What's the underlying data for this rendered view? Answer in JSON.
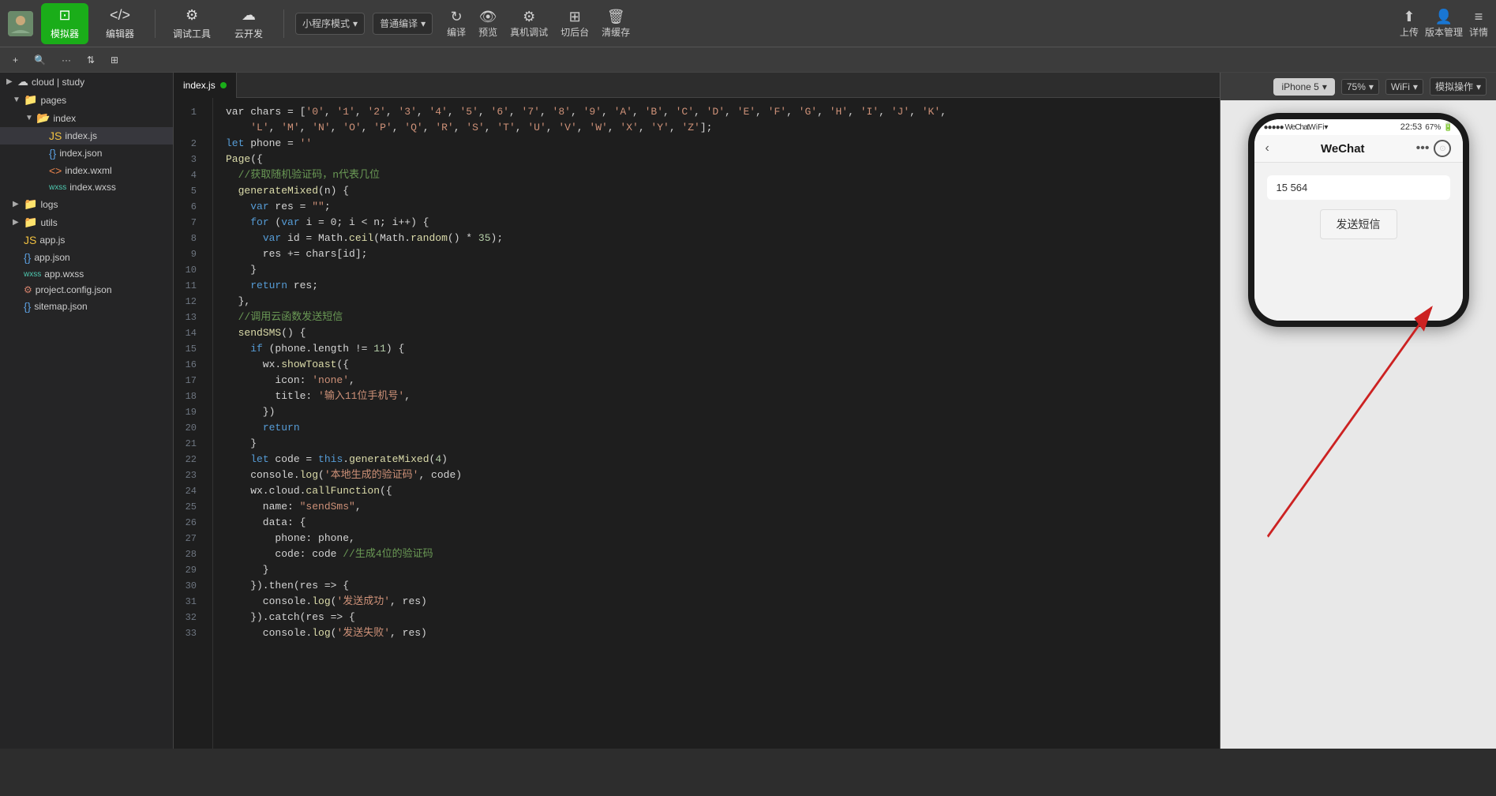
{
  "toolbar": {
    "avatar_alt": "user avatar",
    "simulator_label": "模拟器",
    "editor_label": "编辑器",
    "devtools_label": "调试工具",
    "cloud_label": "云开发",
    "mode_label": "小程序模式",
    "compile_label": "普通编译",
    "compile_btn": "编译",
    "preview_btn": "预览",
    "real_debug_btn": "真机调试",
    "cut_backend_btn": "切后台",
    "clear_cache_btn": "清缓存",
    "upload_btn": "上传",
    "version_btn": "版本管理",
    "detail_btn": "详情"
  },
  "second_toolbar": {
    "add_btn": "+",
    "search_btn": "🔍",
    "more_btn": "···",
    "sort_btn": "⇅",
    "filter_btn": "⊞"
  },
  "sidebar": {
    "items": [
      {
        "label": "cloud | study",
        "type": "root",
        "expanded": false
      },
      {
        "label": "pages",
        "type": "folder",
        "expanded": true,
        "indent": 1
      },
      {
        "label": "index",
        "type": "folder",
        "expanded": true,
        "indent": 2
      },
      {
        "label": "index.js",
        "type": "js",
        "indent": 3,
        "active": true
      },
      {
        "label": "index.json",
        "type": "json",
        "indent": 3
      },
      {
        "label": "index.wxml",
        "type": "wxml",
        "indent": 3
      },
      {
        "label": "index.wxss",
        "type": "wxss",
        "indent": 3
      },
      {
        "label": "logs",
        "type": "folder",
        "expanded": false,
        "indent": 1
      },
      {
        "label": "utils",
        "type": "folder",
        "expanded": false,
        "indent": 1
      },
      {
        "label": "app.js",
        "type": "js",
        "indent": 1
      },
      {
        "label": "app.json",
        "type": "json",
        "indent": 1
      },
      {
        "label": "app.wxss",
        "type": "wxss",
        "indent": 1
      },
      {
        "label": "project.config.json",
        "type": "config",
        "indent": 1
      },
      {
        "label": "sitemap.json",
        "type": "json",
        "indent": 1
      }
    ]
  },
  "editor": {
    "tab": "index.js",
    "lines": [
      {
        "num": 1,
        "tokens": [
          {
            "t": "default",
            "v": "var chars = ["
          },
          {
            "t": "string",
            "v": "'0'"
          },
          {
            "t": "default",
            "v": ", "
          },
          {
            "t": "string",
            "v": "'1'"
          },
          {
            "t": "default",
            "v": ", "
          },
          {
            "t": "string",
            "v": "'2'"
          },
          {
            "t": "default",
            "v": ", "
          },
          {
            "t": "string",
            "v": "'3'"
          },
          {
            "t": "default",
            "v": ", "
          },
          {
            "t": "string",
            "v": "'4'"
          },
          {
            "t": "default",
            "v": ", "
          },
          {
            "t": "string",
            "v": "'5'"
          },
          {
            "t": "default",
            "v": ", "
          },
          {
            "t": "string",
            "v": "'6'"
          },
          {
            "t": "default",
            "v": ", "
          },
          {
            "t": "string",
            "v": "'7'"
          },
          {
            "t": "default",
            "v": ", "
          },
          {
            "t": "string",
            "v": "'8'"
          },
          {
            "t": "default",
            "v": ", "
          },
          {
            "t": "string",
            "v": "'9'"
          },
          {
            "t": "default",
            "v": ", "
          },
          {
            "t": "string",
            "v": "'A'"
          },
          {
            "t": "default",
            "v": ", "
          },
          {
            "t": "string",
            "v": "'B'"
          },
          {
            "t": "default",
            "v": ", "
          },
          {
            "t": "string",
            "v": "'C'"
          },
          {
            "t": "default",
            "v": ", "
          },
          {
            "t": "string",
            "v": "'D'"
          },
          {
            "t": "default",
            "v": ", "
          },
          {
            "t": "string",
            "v": "'E'"
          },
          {
            "t": "default",
            "v": ", "
          },
          {
            "t": "string",
            "v": "'F'"
          },
          {
            "t": "default",
            "v": ", "
          },
          {
            "t": "string",
            "v": "'G'"
          },
          {
            "t": "default",
            "v": ", "
          },
          {
            "t": "string",
            "v": "'H'"
          },
          {
            "t": "default",
            "v": ", "
          },
          {
            "t": "string",
            "v": "'I'"
          },
          {
            "t": "default",
            "v": ", "
          },
          {
            "t": "string",
            "v": "'J'"
          },
          {
            "t": "default",
            "v": ", "
          },
          {
            "t": "string",
            "v": "'K'"
          },
          {
            "t": "default",
            "v": ","
          }
        ]
      },
      {
        "num": "",
        "tokens": [
          {
            "t": "default",
            "v": "    "
          },
          {
            "t": "string",
            "v": "'L'"
          },
          {
            "t": "default",
            "v": ", "
          },
          {
            "t": "string",
            "v": "'M'"
          },
          {
            "t": "default",
            "v": ", "
          },
          {
            "t": "string",
            "v": "'N'"
          },
          {
            "t": "default",
            "v": ", "
          },
          {
            "t": "string",
            "v": "'O'"
          },
          {
            "t": "default",
            "v": ", "
          },
          {
            "t": "string",
            "v": "'P'"
          },
          {
            "t": "default",
            "v": ", "
          },
          {
            "t": "string",
            "v": "'Q'"
          },
          {
            "t": "default",
            "v": ", "
          },
          {
            "t": "string",
            "v": "'R'"
          },
          {
            "t": "default",
            "v": ", "
          },
          {
            "t": "string",
            "v": "'S'"
          },
          {
            "t": "default",
            "v": ", "
          },
          {
            "t": "string",
            "v": "'T'"
          },
          {
            "t": "default",
            "v": ", "
          },
          {
            "t": "string",
            "v": "'U'"
          },
          {
            "t": "default",
            "v": ", "
          },
          {
            "t": "string",
            "v": "'V'"
          },
          {
            "t": "default",
            "v": ", "
          },
          {
            "t": "string",
            "v": "'W'"
          },
          {
            "t": "default",
            "v": ", "
          },
          {
            "t": "string",
            "v": "'X'"
          },
          {
            "t": "default",
            "v": ", "
          },
          {
            "t": "string",
            "v": "'Y'"
          },
          {
            "t": "default",
            "v": ", "
          },
          {
            "t": "string",
            "v": "'Z'"
          },
          {
            "t": "default",
            "v": "];"
          }
        ]
      },
      {
        "num": 2,
        "tokens": [
          {
            "t": "keyword",
            "v": "let"
          },
          {
            "t": "default",
            "v": " phone = "
          },
          {
            "t": "string",
            "v": "''"
          }
        ]
      },
      {
        "num": 3,
        "tokens": [
          {
            "t": "func",
            "v": "Page"
          },
          {
            "t": "default",
            "v": "({"
          }
        ]
      },
      {
        "num": 4,
        "tokens": [
          {
            "t": "comment",
            "v": "  //获取随机验证码，n代表几位"
          }
        ]
      },
      {
        "num": 5,
        "tokens": [
          {
            "t": "default",
            "v": "  "
          },
          {
            "t": "func",
            "v": "generateMixed"
          },
          {
            "t": "default",
            "v": "(n) {"
          }
        ]
      },
      {
        "num": 6,
        "tokens": [
          {
            "t": "default",
            "v": "    "
          },
          {
            "t": "keyword",
            "v": "var"
          },
          {
            "t": "default",
            "v": " res = "
          },
          {
            "t": "string",
            "v": "\"\""
          },
          {
            "t": "default",
            "v": ";"
          }
        ]
      },
      {
        "num": 7,
        "tokens": [
          {
            "t": "default",
            "v": "    "
          },
          {
            "t": "keyword",
            "v": "for"
          },
          {
            "t": "default",
            "v": " ("
          },
          {
            "t": "keyword",
            "v": "var"
          },
          {
            "t": "default",
            "v": " i = 0; i < n; i++) {"
          }
        ]
      },
      {
        "num": 8,
        "tokens": [
          {
            "t": "default",
            "v": "      "
          },
          {
            "t": "keyword",
            "v": "var"
          },
          {
            "t": "default",
            "v": " id = Math."
          },
          {
            "t": "func",
            "v": "ceil"
          },
          {
            "t": "default",
            "v": "(Math."
          },
          {
            "t": "func",
            "v": "random"
          },
          {
            "t": "default",
            "v": "() * "
          },
          {
            "t": "number",
            "v": "35"
          },
          {
            "t": "default",
            "v": ");"
          }
        ]
      },
      {
        "num": 9,
        "tokens": [
          {
            "t": "default",
            "v": "      res += chars[id];"
          }
        ]
      },
      {
        "num": 10,
        "tokens": [
          {
            "t": "default",
            "v": "    }"
          }
        ]
      },
      {
        "num": 11,
        "tokens": [
          {
            "t": "default",
            "v": "    "
          },
          {
            "t": "keyword",
            "v": "return"
          },
          {
            "t": "default",
            "v": " res;"
          }
        ]
      },
      {
        "num": 12,
        "tokens": [
          {
            "t": "default",
            "v": "  },"
          }
        ]
      },
      {
        "num": 13,
        "tokens": [
          {
            "t": "comment",
            "v": "  //调用云函数发送短信"
          }
        ]
      },
      {
        "num": 14,
        "tokens": [
          {
            "t": "default",
            "v": "  "
          },
          {
            "t": "func",
            "v": "sendSMS"
          },
          {
            "t": "default",
            "v": "() {"
          }
        ]
      },
      {
        "num": 15,
        "tokens": [
          {
            "t": "default",
            "v": "    "
          },
          {
            "t": "keyword",
            "v": "if"
          },
          {
            "t": "default",
            "v": " (phone.length != "
          },
          {
            "t": "number",
            "v": "11"
          },
          {
            "t": "default",
            "v": ") {"
          }
        ]
      },
      {
        "num": 16,
        "tokens": [
          {
            "t": "default",
            "v": "      wx."
          },
          {
            "t": "func",
            "v": "showToast"
          },
          {
            "t": "default",
            "v": "({"
          }
        ]
      },
      {
        "num": 17,
        "tokens": [
          {
            "t": "default",
            "v": "        icon: "
          },
          {
            "t": "string",
            "v": "'none'"
          },
          {
            "t": "default",
            "v": ","
          }
        ]
      },
      {
        "num": 18,
        "tokens": [
          {
            "t": "default",
            "v": "        title: "
          },
          {
            "t": "string",
            "v": "'输入11位手机号'"
          },
          {
            "t": "default",
            "v": ","
          }
        ]
      },
      {
        "num": 19,
        "tokens": [
          {
            "t": "default",
            "v": "      })"
          }
        ]
      },
      {
        "num": 20,
        "tokens": [
          {
            "t": "default",
            "v": "      "
          },
          {
            "t": "keyword",
            "v": "return"
          }
        ]
      },
      {
        "num": 21,
        "tokens": [
          {
            "t": "default",
            "v": "    }"
          }
        ]
      },
      {
        "num": 22,
        "tokens": [
          {
            "t": "default",
            "v": "    "
          },
          {
            "t": "keyword",
            "v": "let"
          },
          {
            "t": "default",
            "v": " code = "
          },
          {
            "t": "keyword",
            "v": "this"
          },
          {
            "t": "default",
            "v": "."
          },
          {
            "t": "func",
            "v": "generateMixed"
          },
          {
            "t": "default",
            "v": "("
          },
          {
            "t": "number",
            "v": "4"
          },
          {
            "t": "default",
            "v": ")"
          }
        ]
      },
      {
        "num": 23,
        "tokens": [
          {
            "t": "default",
            "v": "    console."
          },
          {
            "t": "func",
            "v": "log"
          },
          {
            "t": "default",
            "v": "("
          },
          {
            "t": "string",
            "v": "'本地生成的验证码'"
          },
          {
            "t": "default",
            "v": ", code)"
          }
        ]
      },
      {
        "num": 24,
        "tokens": [
          {
            "t": "default",
            "v": "    wx.cloud."
          },
          {
            "t": "func",
            "v": "callFunction"
          },
          {
            "t": "default",
            "v": "({"
          }
        ]
      },
      {
        "num": 25,
        "tokens": [
          {
            "t": "default",
            "v": "      name: "
          },
          {
            "t": "string",
            "v": "\"sendSms\""
          },
          {
            "t": "default",
            "v": ","
          }
        ]
      },
      {
        "num": 26,
        "tokens": [
          {
            "t": "default",
            "v": "      data: {"
          }
        ]
      },
      {
        "num": 27,
        "tokens": [
          {
            "t": "default",
            "v": "        phone: phone,"
          }
        ]
      },
      {
        "num": 28,
        "tokens": [
          {
            "t": "default",
            "v": "        code: code "
          },
          {
            "t": "comment",
            "v": "//生成4位的验证码"
          }
        ]
      },
      {
        "num": 29,
        "tokens": [
          {
            "t": "default",
            "v": "      }"
          }
        ]
      },
      {
        "num": 30,
        "tokens": [
          {
            "t": "default",
            "v": "    }).then(res => {"
          }
        ]
      },
      {
        "num": 31,
        "tokens": [
          {
            "t": "default",
            "v": "      console."
          },
          {
            "t": "func",
            "v": "log"
          },
          {
            "t": "default",
            "v": "("
          },
          {
            "t": "string",
            "v": "'发送成功'"
          },
          {
            "t": "default",
            "v": ", res)"
          }
        ]
      },
      {
        "num": 32,
        "tokens": [
          {
            "t": "default",
            "v": "    }).catch(res => {"
          }
        ]
      },
      {
        "num": 33,
        "tokens": [
          {
            "t": "default",
            "v": "      console."
          },
          {
            "t": "func",
            "v": "log"
          },
          {
            "t": "default",
            "v": "("
          },
          {
            "t": "string",
            "v": "'发送失败'"
          },
          {
            "t": "default",
            "v": ", res)"
          }
        ]
      }
    ]
  },
  "simulator": {
    "device": "iPhone 5",
    "zoom": "75%",
    "network": "WiFi",
    "operation": "模拟操作",
    "status_bar": {
      "signal": "●●●●●",
      "app": "WeChat",
      "signal_icon": "WiFi",
      "time": "22:53",
      "battery": "67%"
    },
    "nav": {
      "title": "WeChat",
      "dots": "•••"
    },
    "content": {
      "input_placeholder": "15        564",
      "send_btn": "发送短信"
    }
  }
}
